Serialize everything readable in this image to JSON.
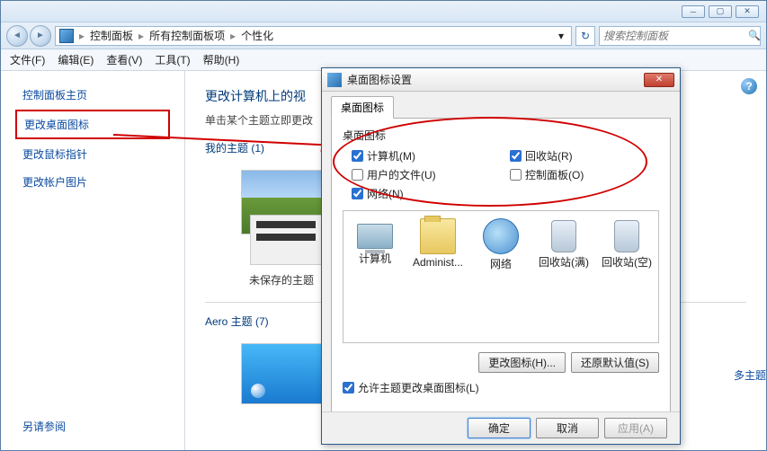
{
  "breadcrumb": {
    "root": "控制面板",
    "mid": "所有控制面板项",
    "leaf": "个性化"
  },
  "search": {
    "placeholder": "搜索控制面板"
  },
  "menubar": {
    "file": "文件(F)",
    "edit": "编辑(E)",
    "view": "查看(V)",
    "tools": "工具(T)",
    "help": "帮助(H)"
  },
  "sidebar": {
    "home": "控制面板主页",
    "desktop_icons": "更改桌面图标",
    "mouse_ptr": "更改鼠标指针",
    "account_pic": "更改帐户图片",
    "see_also": "另请参阅"
  },
  "main": {
    "heading": "更改计算机上的视",
    "subtitle": "单击某个主题立即更改",
    "my_themes": "我的主题 (1)",
    "unsaved": "未保存的主题",
    "aero_themes": "Aero 主题 (7)",
    "more_link": "多主题"
  },
  "dialog": {
    "title": "桌面图标设置",
    "tab": "桌面图标",
    "group": "桌面图标",
    "checks": {
      "computer": "计算机(M)",
      "userfiles": "用户的文件(U)",
      "network": "网络(N)",
      "recycle": "回收站(R)",
      "ctrlpanel": "控制面板(O)"
    },
    "icons": {
      "computer": "计算机",
      "admin": "Administ...",
      "network": "网络",
      "bin_full": "回收站(满)",
      "bin_empty": "回收站(空)"
    },
    "change_icon": "更改图标(H)...",
    "restore": "还原默认值(S)",
    "allow_theme": "允许主题更改桌面图标(L)",
    "ok": "确定",
    "cancel": "取消",
    "apply": "应用(A)"
  }
}
